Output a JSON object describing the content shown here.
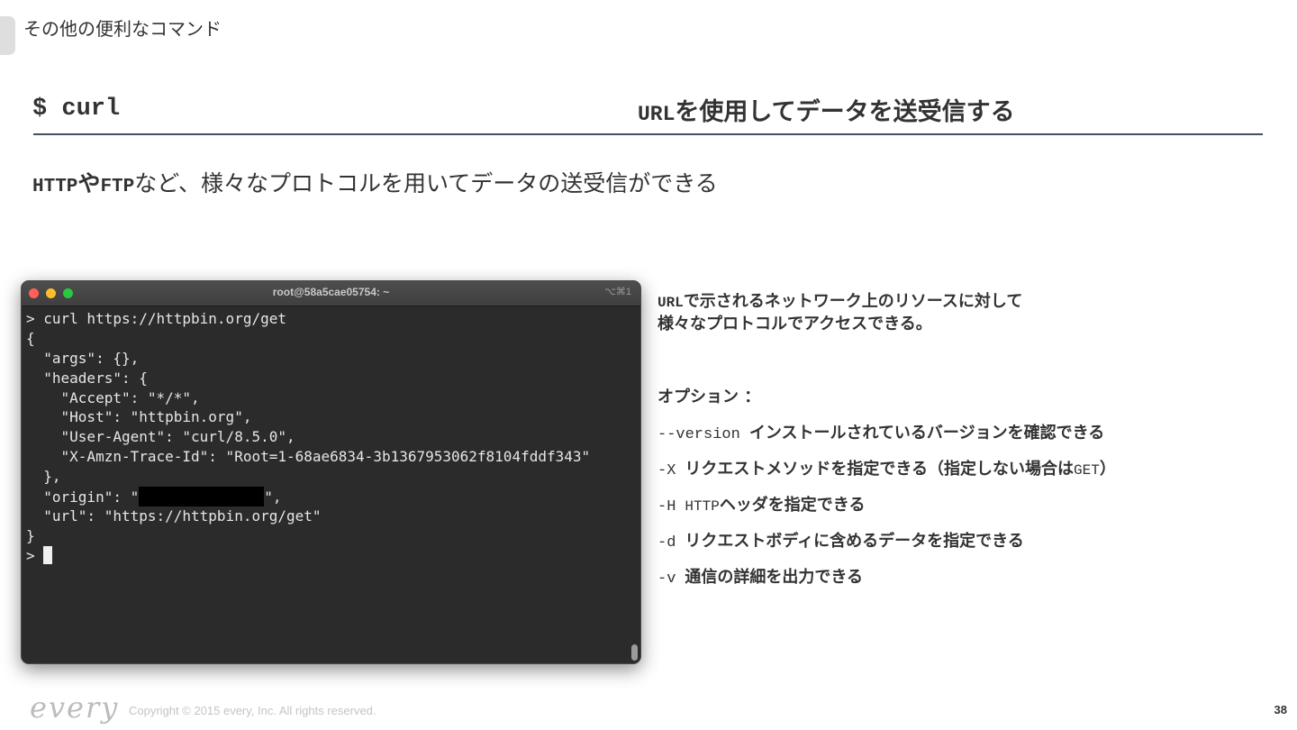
{
  "section": {
    "title": "その他の便利なコマンド"
  },
  "command": {
    "name": "$ curl"
  },
  "headline": {
    "prefix": "URL",
    "text": "を使用してデータを送受信する"
  },
  "lead": {
    "p1": "HTTP",
    "p2": "や",
    "p3": "FTP",
    "p4": "など、様々なプロトコルを用いてデータの送受信ができる"
  },
  "terminal": {
    "title": "root@58a5cae05754: ~",
    "shortcut": "⌥⌘1",
    "lines": [
      "> curl https://httpbin.org/get",
      "{",
      "  \"args\": {},",
      "  \"headers\": {",
      "    \"Accept\": \"*/*\",",
      "    \"Host\": \"httpbin.org\",",
      "    \"User-Agent\": \"curl/8.5.0\",",
      "    \"X-Amzn-Trace-Id\": \"Root=1-68ae6834-3b1367953062f8104fddf343\"",
      "  },"
    ],
    "origin_before": "  \"origin\": \"",
    "origin_after": "\",",
    "lines_after": [
      "  \"url\": \"https://httpbin.org/get\"",
      "}"
    ],
    "prompt": "> "
  },
  "description": {
    "prefix": "URL",
    "line1": "で示されるネットワーク上のリソースに対して",
    "line2": "様々なプロトコルでアクセスできる。"
  },
  "options": {
    "title": "オプション ：",
    "items": [
      {
        "flag": "--version",
        "text": "インストールされているバージョンを確認できる"
      },
      {
        "flag": "-X",
        "text": "リクエストメソッドを指定できる（指定しない場合は",
        "mono": "GET",
        "suffix": "）"
      },
      {
        "flag": "-H",
        "mono": "HTTP",
        "text": "ヘッダを指定できる"
      },
      {
        "flag": "-d",
        "text": "リクエストボディに含めるデータを指定できる"
      },
      {
        "flag": "-v",
        "text": "通信の詳細を出力できる"
      }
    ]
  },
  "footer": {
    "logo": "every",
    "copyright": "Copyright © 2015 every, Inc. All rights reserved.",
    "page": "38"
  }
}
